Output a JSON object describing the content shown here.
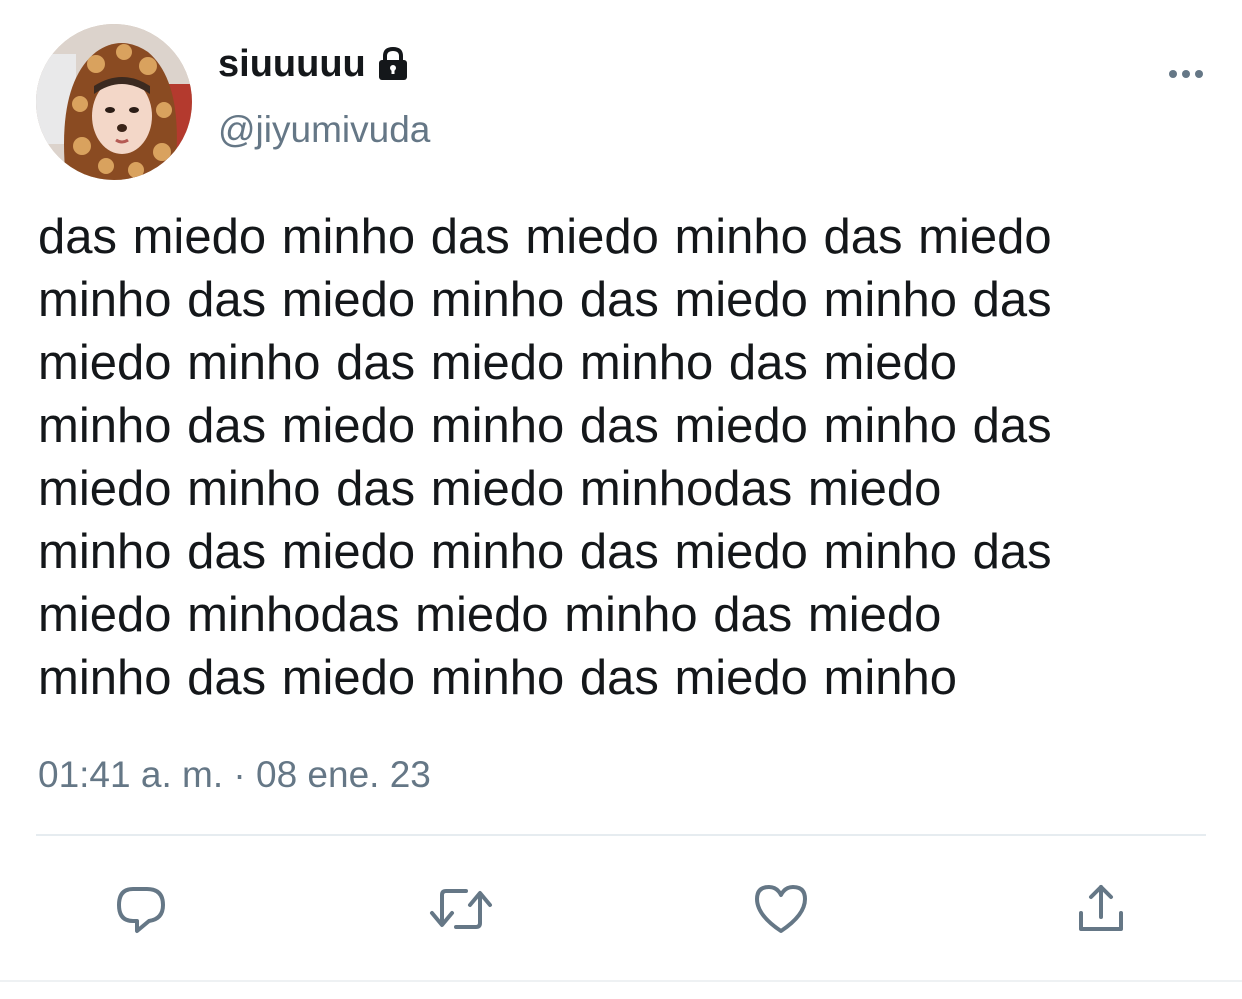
{
  "user": {
    "display_name": "siuuuuu",
    "handle": "@jiyumivuda",
    "protected_icon": "lock-icon",
    "avatar_icon": "profile-photo"
  },
  "tweet": {
    "lines": [
      "das miedo minho das miedo minho das miedo",
      "minho das miedo minho das miedo minho das",
      "miedo minho das miedo minho das miedo",
      "minho das miedo minho das miedo minho das",
      "miedo minho das miedo minhodas miedo",
      "minho das miedo minho das miedo minho das",
      "miedo minhodas miedo minho das miedo",
      "minho das miedo minho das miedo minho"
    ],
    "timestamp": "01:41 a. m. · 08 ene. 23"
  },
  "actions": {
    "reply_icon": "reply-icon",
    "retweet_icon": "retweet-icon",
    "like_icon": "heart-icon",
    "share_icon": "share-icon",
    "more_icon": "more-options-icon"
  },
  "colors": {
    "text_primary": "#14171a",
    "text_secondary": "#657786",
    "divider": "#e6ecf0"
  }
}
